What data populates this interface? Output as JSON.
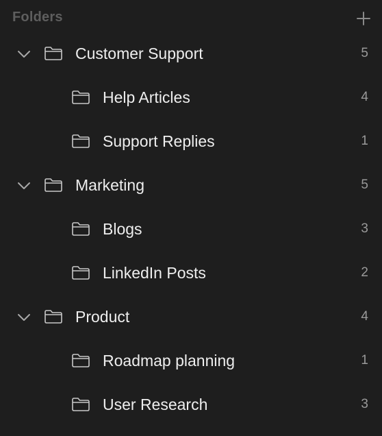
{
  "header": {
    "title": "Folders",
    "add_icon": "plus-icon"
  },
  "colors": {
    "background": "#1e1e1e",
    "text": "#eeeeee",
    "muted": "#5e5e5e",
    "count": "#9a9a9a"
  },
  "groups": [
    {
      "name": "Customer Support",
      "count": "5",
      "expanded": true,
      "children": [
        {
          "name": "Help Articles",
          "count": "4"
        },
        {
          "name": "Support Replies",
          "count": "1"
        }
      ]
    },
    {
      "name": "Marketing",
      "count": "5",
      "expanded": true,
      "children": [
        {
          "name": "Blogs",
          "count": "3"
        },
        {
          "name": "LinkedIn Posts",
          "count": "2"
        }
      ]
    },
    {
      "name": "Product",
      "count": "4",
      "expanded": true,
      "children": [
        {
          "name": "Roadmap planning",
          "count": "1"
        },
        {
          "name": "User Research",
          "count": "3"
        }
      ]
    }
  ]
}
